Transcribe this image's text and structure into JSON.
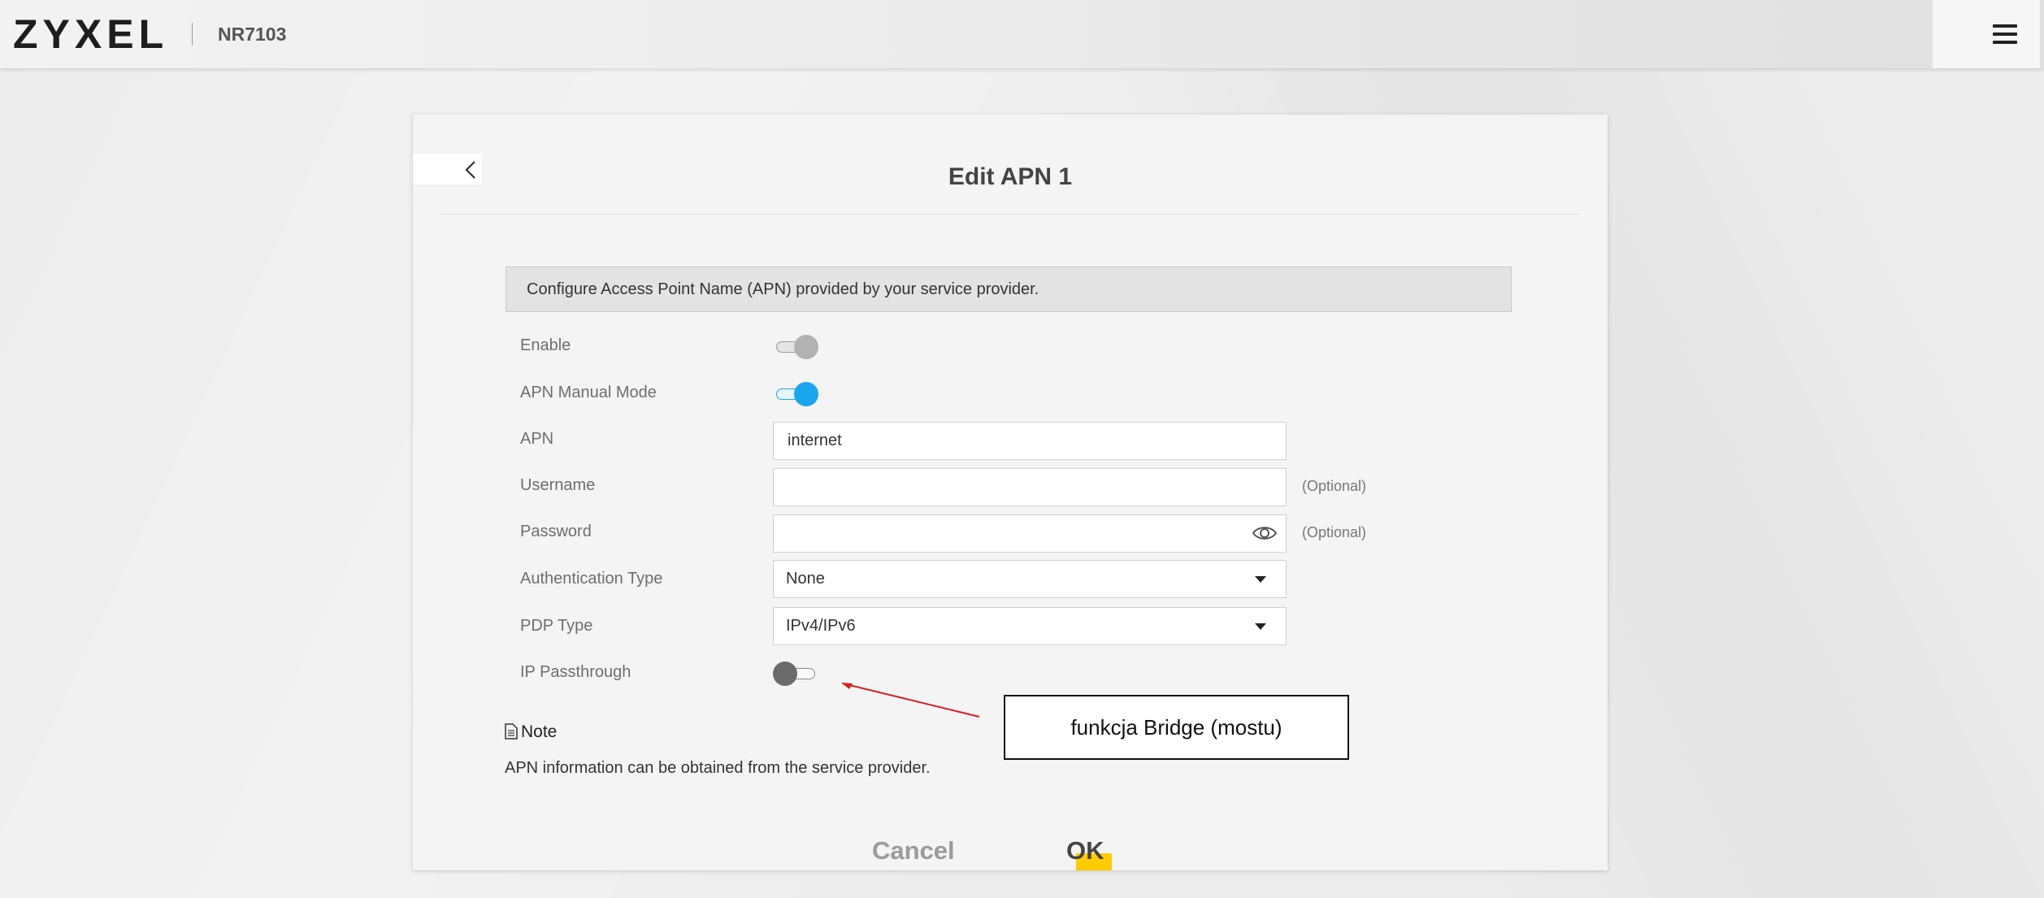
{
  "header": {
    "brand": "ZYXEL",
    "model": "NR7103"
  },
  "panel": {
    "title": "Edit APN 1",
    "info": "Configure Access Point Name (APN) provided by your service provider.",
    "fields": {
      "enable": {
        "label": "Enable",
        "state": "on-disabled"
      },
      "manual_mode": {
        "label": "APN Manual Mode",
        "state": "on"
      },
      "apn": {
        "label": "APN",
        "value": "internet"
      },
      "username": {
        "label": "Username",
        "value": "",
        "hint": "(Optional)"
      },
      "password": {
        "label": "Password",
        "value": "",
        "hint": "(Optional)"
      },
      "auth_type": {
        "label": "Authentication Type",
        "value": "None"
      },
      "pdp_type": {
        "label": "PDP Type",
        "value": "IPv4/IPv6"
      },
      "ip_passthrough": {
        "label": "IP Passthrough",
        "state": "off"
      }
    },
    "note_title": "Note",
    "note_text": "APN information can be obtained from the service provider.",
    "cancel_label": "Cancel",
    "ok_label": "OK"
  },
  "annotation": {
    "callout_text": "funkcja Bridge (mostu)",
    "arrow_color": "#d62020"
  },
  "colors": {
    "accent": "#1aa6ee",
    "ok_highlight": "#ffcc00"
  }
}
